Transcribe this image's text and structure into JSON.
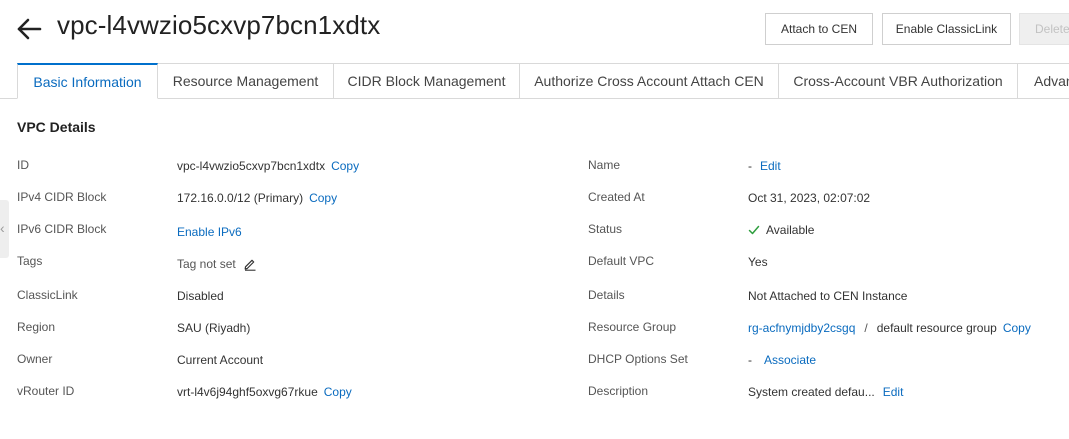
{
  "header": {
    "title": "vpc-l4vwzio5cxvp7bcn1xdtx",
    "buttons": {
      "attach_cen": "Attach to CEN",
      "enable_classiclink": "Enable ClassicLink",
      "delete": "Delete"
    }
  },
  "tabs": [
    {
      "label": "Basic Information"
    },
    {
      "label": "Resource Management"
    },
    {
      "label": "CIDR Block Management"
    },
    {
      "label": "Authorize Cross Account Attach CEN"
    },
    {
      "label": "Cross-Account VBR Authorization"
    },
    {
      "label": "Advan"
    }
  ],
  "section_title": "VPC Details",
  "left": {
    "id": {
      "label": "ID",
      "value": "vpc-l4vwzio5cxvp7bcn1xdtx",
      "action": "Copy"
    },
    "ipv4": {
      "label": "IPv4 CIDR Block",
      "value": "172.16.0.0/12 (Primary)",
      "action": "Copy"
    },
    "ipv6": {
      "label": "IPv6 CIDR Block",
      "link": "Enable IPv6"
    },
    "tags": {
      "label": "Tags",
      "value": "Tag not set",
      "icon": "edit-icon"
    },
    "classiclink": {
      "label": "ClassicLink",
      "value": "Disabled"
    },
    "region": {
      "label": "Region",
      "value": "SAU (Riyadh)"
    },
    "owner": {
      "label": "Owner",
      "value": "Current Account"
    },
    "vrouter": {
      "label": "vRouter ID",
      "value": "vrt-l4v6j94ghf5oxvg67rkue",
      "action": "Copy"
    }
  },
  "right": {
    "name": {
      "label": "Name",
      "value": "-",
      "action": "Edit"
    },
    "created": {
      "label": "Created At",
      "value": "Oct 31, 2023, 02:07:02"
    },
    "status": {
      "label": "Status",
      "value": "Available",
      "icon": "check-icon",
      "color": "#2e9e3e"
    },
    "default_vpc": {
      "label": "Default VPC",
      "value": "Yes"
    },
    "details": {
      "label": "Details",
      "value": "Not Attached to CEN Instance"
    },
    "resource_group": {
      "label": "Resource Group",
      "link": "rg-acfnymjdby2csgq",
      "separator": "/",
      "value": "default resource group",
      "action": "Copy"
    },
    "dhcp": {
      "label": "DHCP Options Set",
      "value": "-",
      "action": "Associate"
    },
    "description": {
      "label": "Description",
      "value": "System created defau...",
      "action": "Edit"
    }
  },
  "colors": {
    "link": "#0a6bbf",
    "tab_active": "#0070cc",
    "status_ok": "#2e9e3e"
  }
}
